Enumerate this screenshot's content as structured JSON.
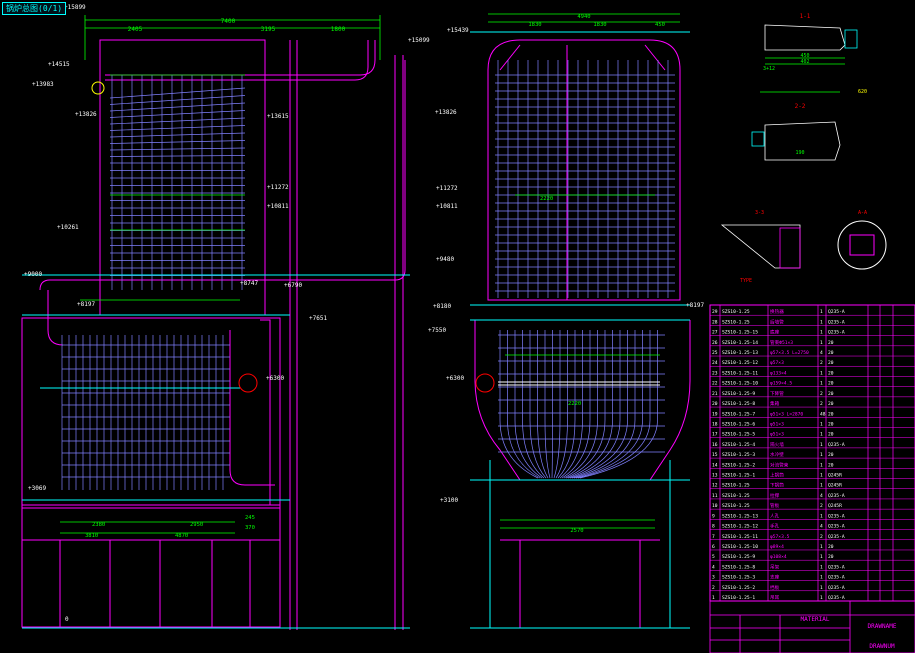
{
  "title_tag": "锅炉总图(0/1)",
  "colors": {
    "background": "#000000",
    "outline": "#ff00ff",
    "tubes": "#8080ff",
    "dimension": "#00ff00",
    "elevation": "#ffffff",
    "structure": "#00ffff",
    "marker": "#ff0000",
    "text_yellow": "#ffff00"
  },
  "left_view": {
    "top_dim_total": "7400",
    "top_dims": [
      "2405",
      "3195",
      "1800"
    ],
    "elevations": [
      "+15899",
      "+14515",
      "+13983",
      "+13826",
      "+13615",
      "+11272",
      "+10811",
      "+10261",
      "+9000",
      "+8197",
      "+8747",
      "+6790",
      "+7651",
      "+6300",
      "+3069",
      "0"
    ],
    "bottom_dims": [
      "2380",
      "2950",
      "4870",
      "245",
      "370",
      "3810"
    ]
  },
  "center_left": {
    "elevation_top": "+15099"
  },
  "right_view": {
    "top_dims": [
      "4940",
      "1830",
      "1830",
      "450"
    ],
    "elevations": [
      "+15439",
      "+13826",
      "+11272",
      "+10811",
      "+9480",
      "+8180",
      "+7550",
      "+6300",
      "+3100",
      "+8197"
    ],
    "bottom_dim": "2570",
    "band_labels": [
      "2220",
      "2220"
    ]
  },
  "details": {
    "d1_label": "1-1",
    "d2_label": "2-2",
    "d3_label": "3-3",
    "d4_label": "A-A",
    "notes": [
      "TYPE",
      "450",
      "402",
      "190",
      "3+12",
      "620"
    ]
  },
  "parts_table": {
    "rows": [
      [
        "29",
        "SZS10-1.25",
        "换热器",
        "1",
        "Q235-A",
        "",
        "",
        ""
      ],
      [
        "28",
        "SZS10-1.25",
        "后墙管",
        "1",
        "Q235-A",
        "",
        "",
        ""
      ],
      [
        "27",
        "SZS10-1.25-15",
        "底座",
        "1",
        "Q235-A",
        "",
        "",
        ""
      ],
      [
        "26",
        "SZS10-1.25-14",
        "管束Ф51×3",
        "1",
        "20",
        "",
        "",
        ""
      ],
      [
        "25",
        "SZS10-1.25-13",
        "φ57×3.5 L=2750",
        "4",
        "20",
        "",
        "",
        ""
      ],
      [
        "24",
        "SZS10-1.25-12",
        "φ57×3",
        "2",
        "20",
        "",
        "",
        ""
      ],
      [
        "23",
        "SZS10-1.25-11",
        "φ133×4",
        "1",
        "20",
        "",
        "",
        ""
      ],
      [
        "22",
        "SZS10-1.25-10",
        "φ159×4.5",
        "1",
        "20",
        "",
        "",
        ""
      ],
      [
        "21",
        "SZS10-1.25-9",
        "下降管",
        "2",
        "20",
        "",
        "",
        ""
      ],
      [
        "20",
        "SZS10-1.25-8",
        "集箱",
        "2",
        "20",
        "",
        "",
        ""
      ],
      [
        "19",
        "SZS10-1.25-7",
        "φ51×3 L=2870",
        "48",
        "20",
        "",
        "",
        ""
      ],
      [
        "18",
        "SZS10-1.25-6",
        "φ51×3",
        "1",
        "20",
        "",
        "",
        ""
      ],
      [
        "17",
        "SZS10-1.25-5",
        "φ51×3",
        "1",
        "20",
        "",
        "",
        ""
      ],
      [
        "16",
        "SZS10-1.25-4",
        "隔火墙",
        "1",
        "Q235-A",
        "",
        "",
        ""
      ],
      [
        "15",
        "SZS10-1.25-3",
        "水冷壁",
        "1",
        "20",
        "",
        "",
        ""
      ],
      [
        "14",
        "SZS10-1.25-2",
        "对流管束",
        "1",
        "20",
        "",
        "",
        ""
      ],
      [
        "13",
        "SZS10-1.25-1",
        "上锅筒",
        "1",
        "Q245R",
        "",
        "",
        ""
      ],
      [
        "12",
        "SZS10-1.25",
        "下锅筒",
        "1",
        "Q245R",
        "",
        "",
        ""
      ],
      [
        "11",
        "SZS10-1.25",
        "拉撑",
        "4",
        "Q235-A",
        "",
        "",
        ""
      ],
      [
        "10",
        "SZS10-1.25",
        "管板",
        "2",
        "Q245R",
        "",
        "",
        ""
      ],
      [
        "9",
        "SZS10-1.25-13",
        "人孔",
        "1",
        "Q235-A",
        "",
        "",
        ""
      ],
      [
        "8",
        "SZS10-1.25-12",
        "手孔",
        "4",
        "Q235-A",
        "",
        "",
        ""
      ],
      [
        "7",
        "SZS10-1.25-11",
        "φ57×3.5",
        "2",
        "Q235-A",
        "",
        "",
        ""
      ],
      [
        "6",
        "SZS10-1.25-10",
        "φ89×4",
        "1",
        "20",
        "",
        "",
        ""
      ],
      [
        "5",
        "SZS10-1.25-9",
        "φ108×4",
        "1",
        "20",
        "",
        "",
        ""
      ],
      [
        "4",
        "SZS10-1.25-8",
        "吊架",
        "1",
        "Q235-A",
        "",
        "",
        ""
      ],
      [
        "3",
        "SZS10-1.25-3",
        "支座",
        "1",
        "Q235-A",
        "",
        "",
        ""
      ],
      [
        "2",
        "SZS10-1.25-2",
        "挡板",
        "1",
        "Q235-A",
        "",
        "",
        ""
      ],
      [
        "1",
        "SZS10-1.25-1",
        "吊耳",
        "1",
        "Q235-A",
        "",
        "",
        ""
      ]
    ],
    "material_label": "MATERIAL",
    "drawname_label": "DRAWNAME",
    "drawnum_label": "DRAWNUM"
  }
}
